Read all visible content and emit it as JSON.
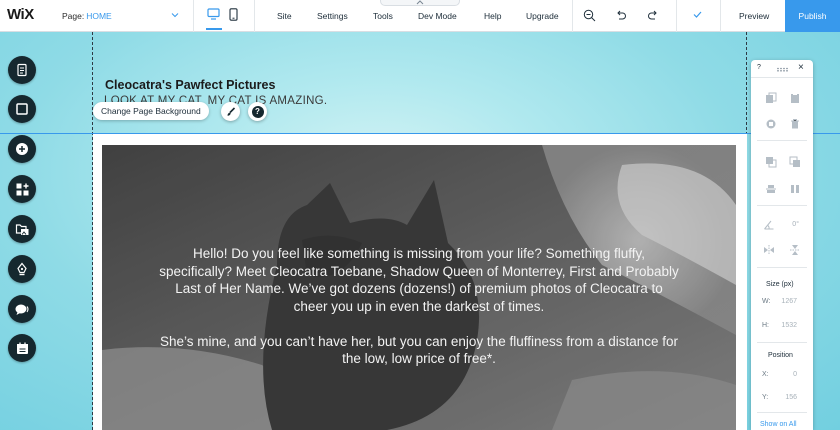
{
  "topbar": {
    "logo": "WiX",
    "page_label": "Page:",
    "page_value": "HOME",
    "menu": [
      "Site",
      "Settings",
      "Tools",
      "Dev Mode",
      "Help",
      "Upgrade"
    ],
    "preview": "Preview",
    "publish": "Publish"
  },
  "header": {
    "site_title": "Cleocatra's Pawfect Pictures",
    "tagline": "LOOK AT MY CAT. MY CAT IS AMAZING.",
    "change_bg_label": "Change Page Background",
    "help_glyph": "?"
  },
  "strip": {
    "paragraph1": "Hello! Do you feel like something is missing from your life? Something fluffy, specifically? Meet Cleocatra Toebane, Shadow Queen of Monterrey, First and Probably Last of Her Name. We’ve got dozens (dozens!) of premium photos of Cleocatra to cheer you up in even the darkest of times.",
    "paragraph2": "She’s mine, and you can’t have her, but you can enjoy the fluffiness from a distance for the low, low price of free*."
  },
  "left_rail": [
    "pages-icon",
    "background-icon",
    "add-icon",
    "add-apps-icon",
    "media-icon",
    "blog-icon",
    "chat-icon",
    "bookings-icon"
  ],
  "right_panel": {
    "help": "?",
    "close": "×",
    "rotation": "0°",
    "size_label": "Size (px)",
    "w_label": "W:",
    "w_value": "1267",
    "h_label": "H:",
    "h_value": "1532",
    "position_label": "Position",
    "x_label": "X:",
    "x_value": "0",
    "y_label": "Y:",
    "y_value": "156",
    "show_on_all": "Show on All"
  },
  "colors": {
    "accent": "#3899ec",
    "rail": "#16282f"
  }
}
